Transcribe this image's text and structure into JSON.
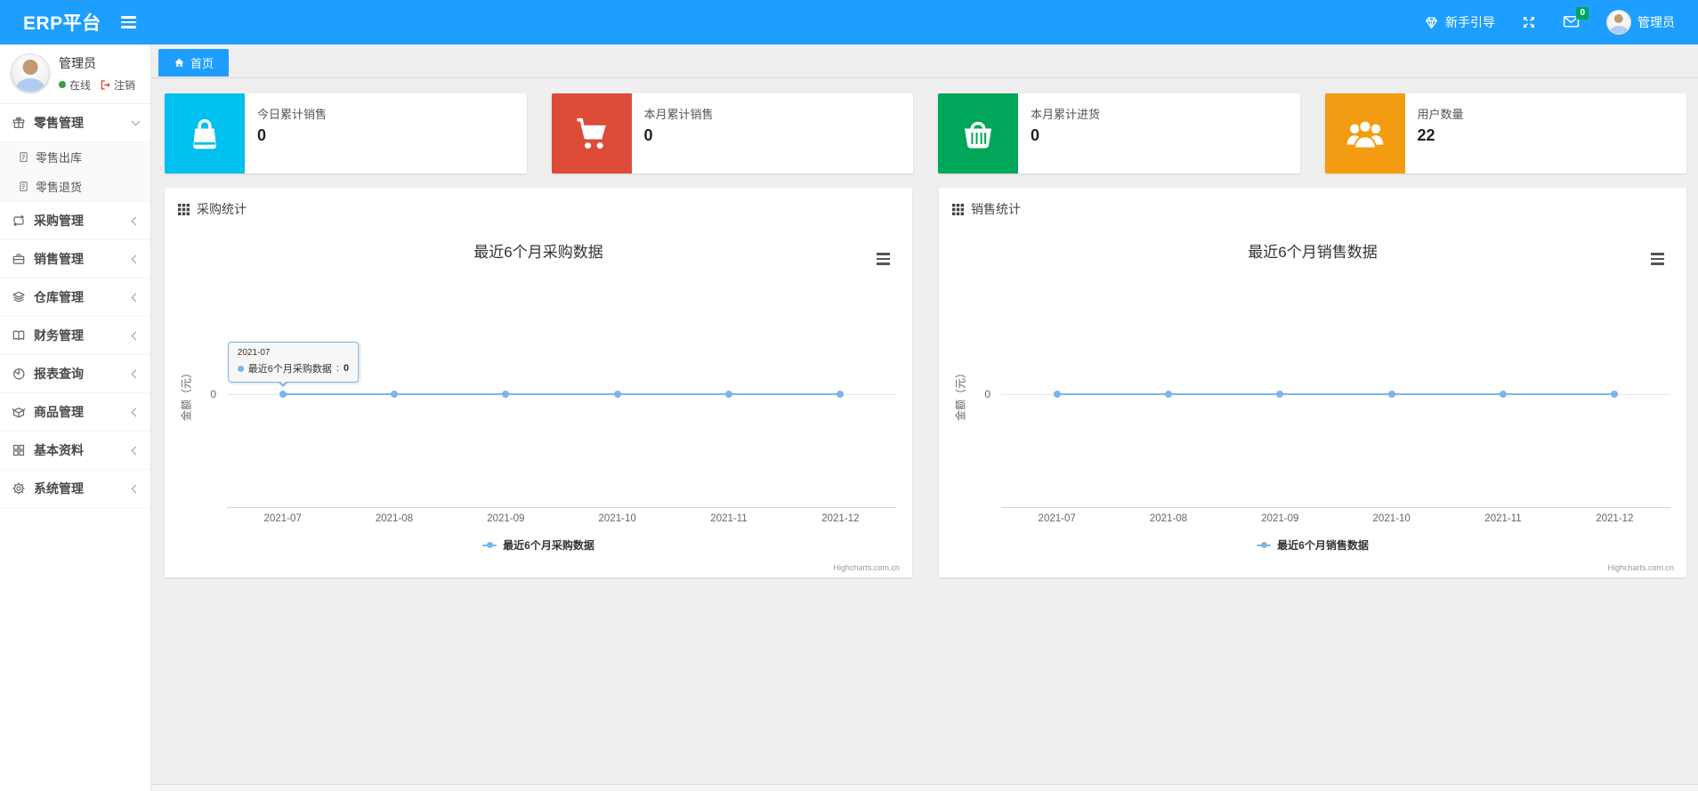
{
  "app": {
    "brand": "ERP平台"
  },
  "header": {
    "menu_toggle_icon": "menu-icon",
    "guide": {
      "icon": "gem-icon",
      "label": "新手引导"
    },
    "fullscreen_icon": "fullscreen-icon",
    "mail": {
      "icon": "mail-icon",
      "badge": "0"
    },
    "user": {
      "icon": "avatar",
      "name": "管理员"
    }
  },
  "sidebar": {
    "user": {
      "name": "管理员",
      "status_icon": "status-dot-icon",
      "status_label": "在线",
      "logout_icon": "logout-icon",
      "logout_label": "注销"
    },
    "menu": [
      {
        "label": "零售管理",
        "icon": "gift-icon",
        "expanded": true,
        "children": [
          {
            "label": "零售出库",
            "icon": "document-icon"
          },
          {
            "label": "零售退货",
            "icon": "document-icon"
          }
        ]
      },
      {
        "label": "采购管理",
        "icon": "repeat-icon"
      },
      {
        "label": "销售管理",
        "icon": "briefcase-icon"
      },
      {
        "label": "仓库管理",
        "icon": "layers-icon"
      },
      {
        "label": "财务管理",
        "icon": "book-icon"
      },
      {
        "label": "报表查询",
        "icon": "pie-chart-icon"
      },
      {
        "label": "商品管理",
        "icon": "package-icon"
      },
      {
        "label": "基本资料",
        "icon": "grid-icon"
      },
      {
        "label": "系统管理",
        "icon": "gear-icon"
      }
    ]
  },
  "tabbar": {
    "home_icon": "home-icon",
    "home_label": "首页"
  },
  "cards": [
    {
      "title": "今日累计销售",
      "value": "0",
      "icon": "shopping-bag-icon",
      "color": "#00c0ef"
    },
    {
      "title": "本月累计销售",
      "value": "0",
      "icon": "shopping-cart-icon",
      "color": "#dd4b39"
    },
    {
      "title": "本月累计进货",
      "value": "0",
      "icon": "shopping-basket-icon",
      "color": "#00a65a"
    },
    {
      "title": "用户数量",
      "value": "22",
      "icon": "users-icon",
      "color": "#f39c12"
    }
  ],
  "chart_data": [
    {
      "type": "line",
      "panel_title": "采购统计",
      "panel_icon": "th-grid-icon",
      "title": "最近6个月采购数据",
      "categories": [
        "2021-07",
        "2021-08",
        "2021-09",
        "2021-10",
        "2021-11",
        "2021-12"
      ],
      "series": [
        {
          "name": "最近6个月采购数据",
          "values": [
            0,
            0,
            0,
            0,
            0,
            0
          ],
          "color": "#7cb5ec"
        }
      ],
      "ylabel": "金额（元）",
      "yticks": [
        "0"
      ],
      "grid": true,
      "legend_position": "bottom",
      "credits": "Highcharts.com.cn",
      "tooltip": {
        "header": "2021-07",
        "series": "最近6个月采购数据",
        "separator": ": ",
        "value": "0"
      }
    },
    {
      "type": "line",
      "panel_title": "销售统计",
      "panel_icon": "th-grid-icon",
      "title": "最近6个月销售数据",
      "categories": [
        "2021-07",
        "2021-08",
        "2021-09",
        "2021-10",
        "2021-11",
        "2021-12"
      ],
      "series": [
        {
          "name": "最近6个月销售数据",
          "values": [
            0,
            0,
            0,
            0,
            0,
            0
          ],
          "color": "#7cb5ec"
        }
      ],
      "ylabel": "金额（元）",
      "yticks": [
        "0"
      ],
      "grid": true,
      "legend_position": "bottom",
      "credits": "Highcharts.com.cn"
    }
  ],
  "colors": {
    "header_bg": "#1e9fff",
    "series_line": "#7cb5ec",
    "card_cyan": "#00c0ef",
    "card_red": "#dd4b39",
    "card_green": "#00a65a",
    "card_orange": "#f39c12",
    "mail_badge_bg": "#00a65a",
    "online_dot": "#3b9e3b"
  }
}
